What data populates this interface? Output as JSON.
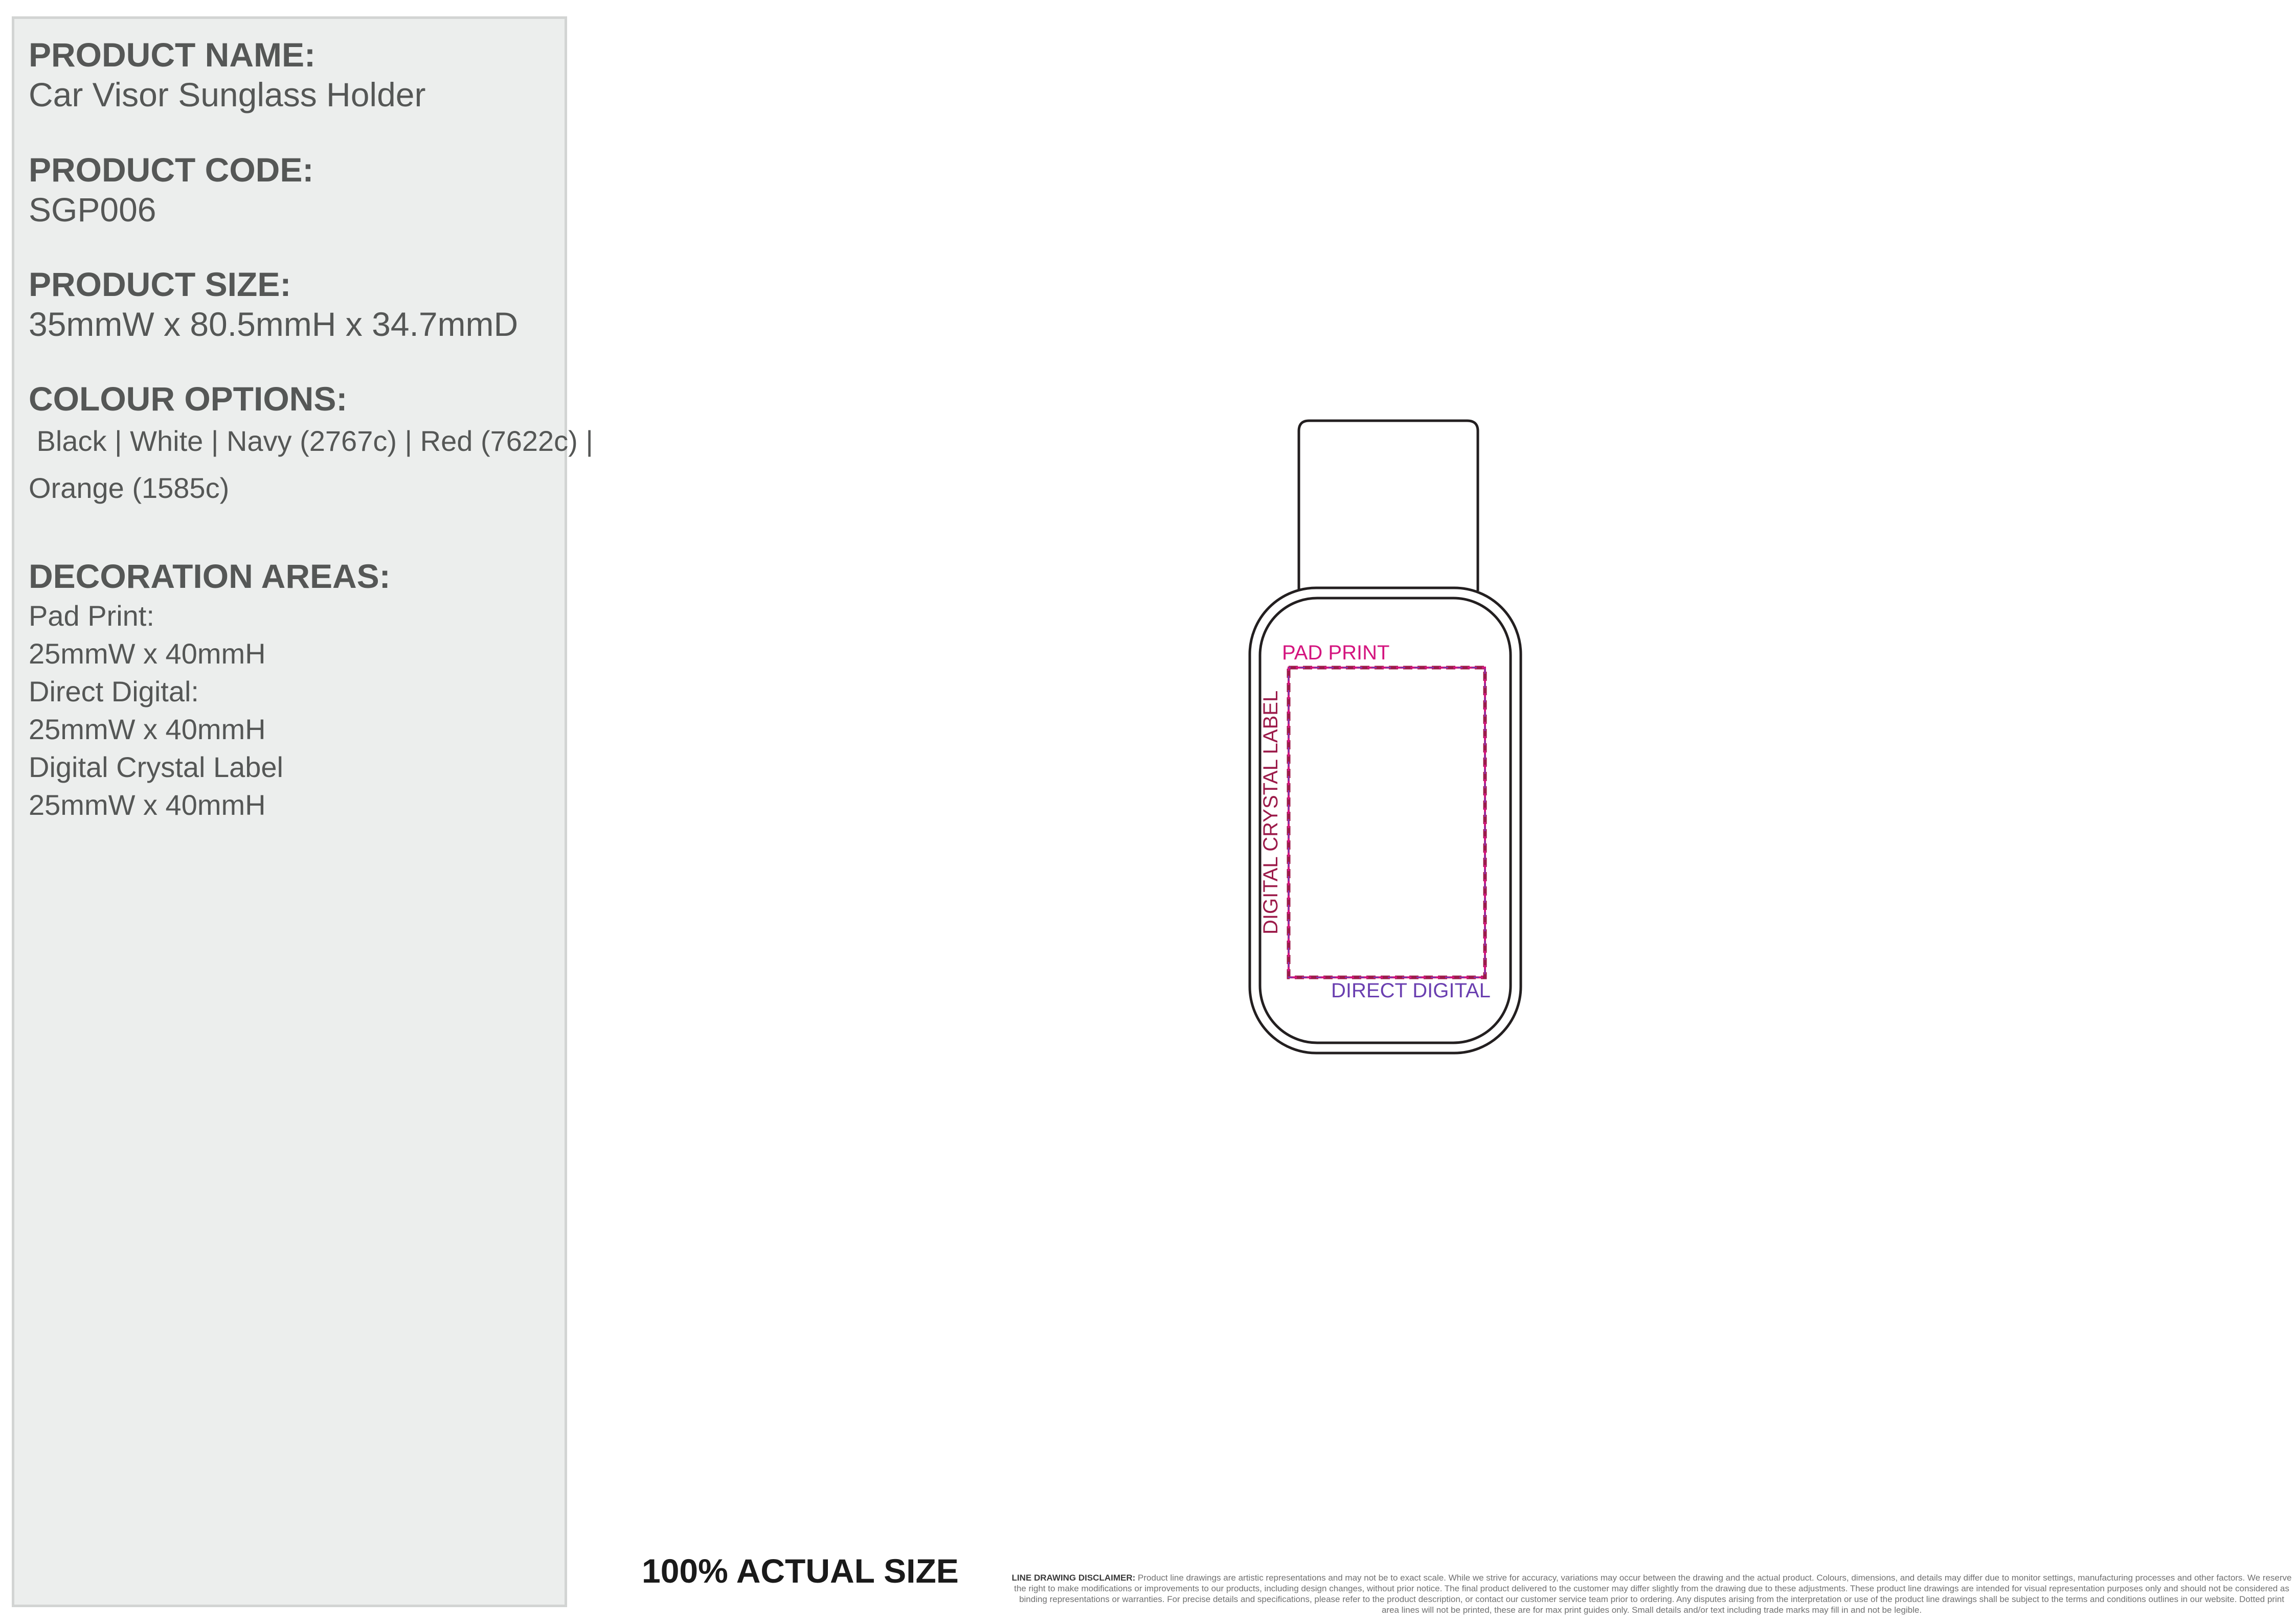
{
  "sidebar": {
    "product_name_heading": "PRODUCT NAME:",
    "product_name": "Car Visor Sunglass Holder",
    "product_code_heading": "PRODUCT CODE:",
    "product_code": "SGP006",
    "product_size_heading": "PRODUCT SIZE:",
    "product_size": "35mmW x 80.5mmH x 34.7mmD",
    "colour_options_heading": "COLOUR OPTIONS:",
    "colour_options_line1": " Black | White | Navy (2767c) | Red (7622c) |",
    "colour_options_line2": "Orange (1585c)",
    "decoration_heading": "DECORATION AREAS:",
    "decoration_lines": [
      "Pad Print:",
      "25mmW x 40mmH",
      "Direct Digital:",
      "25mmW x 40mmH",
      "Digital Crystal Label",
      "25mmW x 40mmH"
    ]
  },
  "drawing": {
    "pad_print_label": "PAD PRINT",
    "direct_digital_label": "DIRECT DIGITAL",
    "crystal_label": "DIGITAL CRYSTAL LABEL",
    "colors": {
      "pad_print": "#d4157f",
      "direct_digital": "#6a3fb0",
      "crystal_label": "#9c1b4a",
      "outline": "#231f20"
    }
  },
  "footer": {
    "actual_size": "100% ACTUAL SIZE",
    "disclaimer_label": "LINE DRAWING DISCLAIMER:",
    "disclaimer_text": "Product line drawings are artistic representations and may not be to exact scale. While we strive for accuracy, variations may occur between the drawing and the actual product. Colours, dimensions, and details may differ due to monitor settings, manufacturing processes and other factors. We reserve the right to make modifications or improvements to our products, including design changes, without prior notice. The final product delivered to the customer may differ slightly from the drawing due to these adjustments. These product line drawings are intended for visual representation purposes only and should not be considered as binding representations or warranties. For precise details and specifications, please refer to the product description, or contact our customer service team prior to ordering. Any disputes arising from the interpretation or use of the product line drawings shall be subject to the terms and conditions outlines in our website. Dotted print area lines will not be printed, these are for max print guides only. Small details and/or text including trade marks may fill in and not be legible."
  }
}
